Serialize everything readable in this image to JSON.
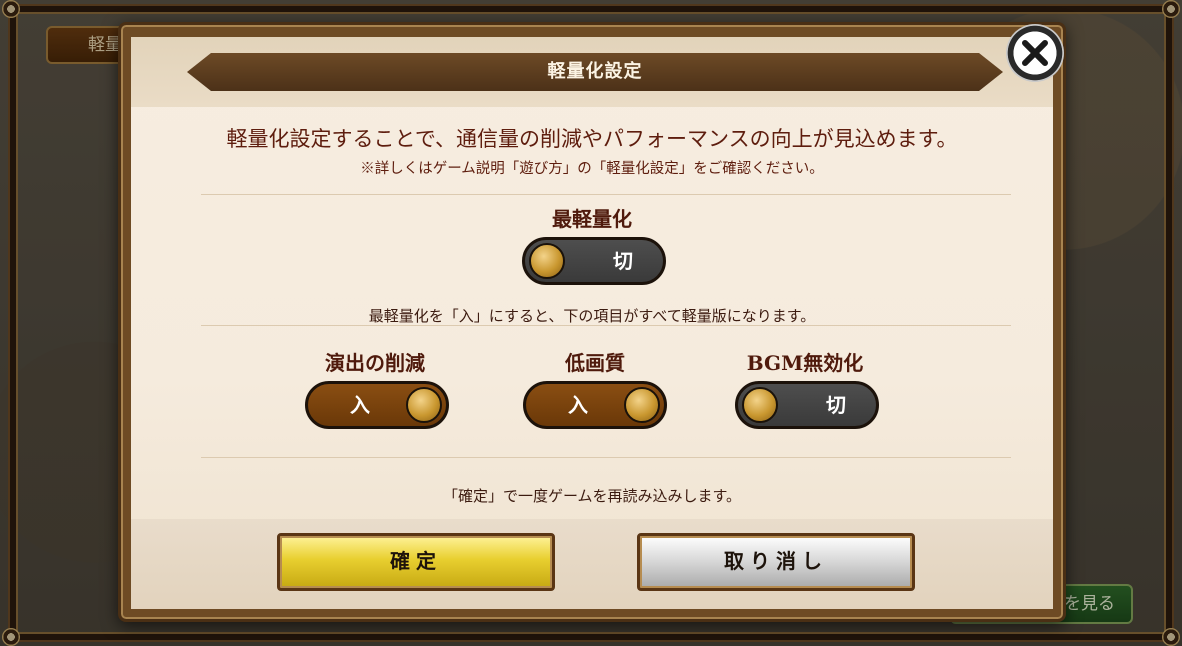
{
  "background": {
    "top_button_label": "軽量",
    "bottom_button_label": "を見る"
  },
  "dialog": {
    "title": "軽量化設定",
    "intro": "軽量化設定することで、通信量の削減やパフォーマンスの向上が見込めます。",
    "note": "※詳しくはゲーム説明「遊び方」の「軽量化設定」をご確認ください。",
    "lightest": {
      "label": "最軽量化",
      "state": "切",
      "on": false
    },
    "lightest_note": "最軽量化を「入」にすると、下の項目がすべて軽量版になります。",
    "settings": [
      {
        "label": "演出の削減",
        "state": "入",
        "on": true
      },
      {
        "label": "低画質",
        "state": "入",
        "on": true
      },
      {
        "label": "BGM無効化",
        "state": "切",
        "on": false
      }
    ],
    "reload_note": "「確定」で一度ゲームを再読み込みします。",
    "confirm_label": "確定",
    "cancel_label": "取り消し"
  },
  "icons": {
    "close": "close-icon"
  },
  "colors": {
    "title_banner": "#5a3b1c",
    "text_dark_red": "#5e1d0e",
    "toggle_on": "#7a4410",
    "toggle_off": "#444444",
    "confirm_gold": "#e8cf2f",
    "cancel_silver": "#d6d6d6"
  }
}
